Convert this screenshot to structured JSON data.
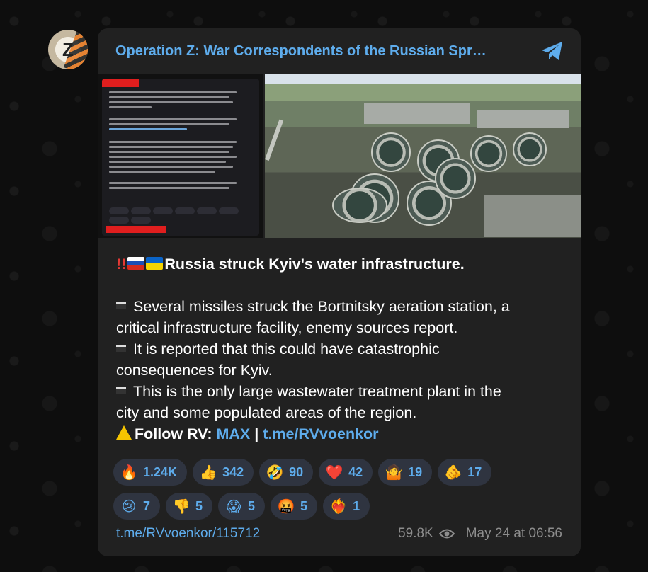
{
  "channel": {
    "title": "Operation Z: War Correspondents of the Russian Spr…",
    "avatar_letter": "Z"
  },
  "media": {
    "left_alt": "screenshot",
    "right_alt": "aerial photo"
  },
  "post": {
    "headline": "Russia struck Kyiv's water infrastructure.",
    "bullets": [
      "Several missiles struck the Bortnitsky aeration station, a",
      "critical infrastructure facility, enemy sources report.",
      "It is reported that this could have catastrophic",
      "consequences for Kyiv.",
      "This is the only large wastewater treatment plant in the",
      "city and some populated areas of the region."
    ],
    "follow_label": "Follow RV:",
    "follow_link_1": "MAX",
    "separator": "|",
    "follow_link_2": "t.me/RVvoenkor"
  },
  "reactions": {
    "row1": [
      {
        "emoji": "🔥",
        "count": "1.24K"
      },
      {
        "emoji": "👍",
        "count": "342"
      },
      {
        "emoji": "🤣",
        "count": "90"
      },
      {
        "emoji": "❤️",
        "count": "42"
      },
      {
        "emoji": "🤷",
        "count": "19"
      },
      {
        "emoji": "🫵",
        "count": "17"
      }
    ],
    "row2": [
      {
        "emoji": "😢",
        "count": "7"
      },
      {
        "emoji": "👎",
        "count": "5"
      },
      {
        "emoji": "😱",
        "count": "5"
      },
      {
        "emoji": "🤬",
        "count": "5"
      },
      {
        "emoji": "❤️‍🔥",
        "count": "1"
      }
    ]
  },
  "footer": {
    "post_link": "t.me/RVvoenkor/115712",
    "views": "59.8K",
    "date": "May 24 at 06:56"
  },
  "colors": {
    "accent": "#5eacec",
    "card": "#212121",
    "background": "#0e0e0e",
    "reaction_bg": "#2f3440"
  }
}
